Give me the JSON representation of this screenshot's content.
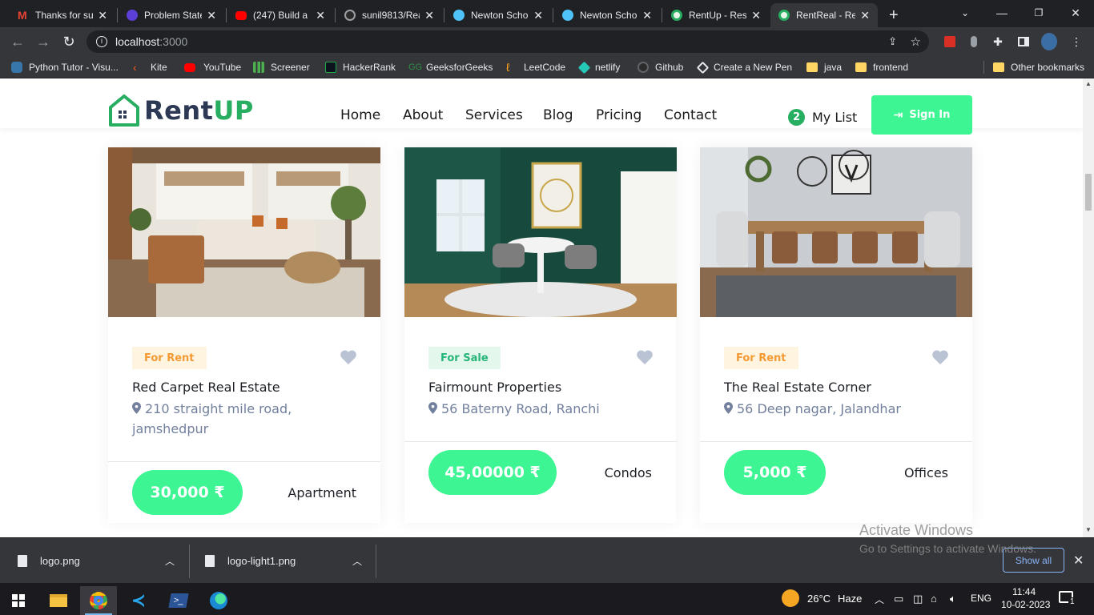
{
  "browser": {
    "tabs": [
      {
        "title": "Thanks for su",
        "favicon_color": "#ea4335"
      },
      {
        "title": "Problem State",
        "favicon_color": "#7b61ff"
      },
      {
        "title": "(247) Build a l",
        "favicon_color": "#ff0000"
      },
      {
        "title": "sunil9813/Rea",
        "favicon_color": "#9aa0a6"
      },
      {
        "title": "Newton Scho",
        "favicon_color": "#4fc3f7"
      },
      {
        "title": "Newton Scho",
        "favicon_color": "#4fc3f7"
      },
      {
        "title": "RentUp - Resi",
        "favicon_color": "#27ae60"
      },
      {
        "title": "RentReal - Re",
        "favicon_color": "#27ae60",
        "active": true
      }
    ],
    "new_tab_label": "+",
    "url": {
      "host": "localhost",
      "port": ":3000"
    },
    "bookmarks": [
      {
        "label": "Python Tutor - Visu...",
        "color": "#3776ab"
      },
      {
        "label": "Kite",
        "color": "#ff5722"
      },
      {
        "label": "YouTube",
        "color": "#ff0000"
      },
      {
        "label": "Screener",
        "color": "#4caf50"
      },
      {
        "label": "HackerRank",
        "color": "#1ba94c"
      },
      {
        "label": "GeeksforGeeks",
        "color": "#2f8d46"
      },
      {
        "label": "LeetCode",
        "color": "#ffa116"
      },
      {
        "label": "netlify",
        "color": "#25c7b7"
      },
      {
        "label": "Github",
        "color": "#9aa0a6"
      },
      {
        "label": "Create a New Pen",
        "color": "#e8eaed"
      },
      {
        "label": "java",
        "color": "#fdd663"
      },
      {
        "label": "frontend",
        "color": "#fdd663"
      }
    ],
    "other_bookmarks": "Other bookmarks"
  },
  "site": {
    "logo": {
      "part1": "Rent",
      "part2": "UP"
    },
    "nav": [
      "Home",
      "About",
      "Services",
      "Blog",
      "Pricing",
      "Contact"
    ],
    "my_list": {
      "count": "2",
      "label": "My List"
    },
    "sign_in": "Sign In",
    "colors": {
      "accent": "#3ef593",
      "brand_green": "#27ae60"
    }
  },
  "listings": [
    {
      "badge": "For Rent",
      "badge_type": "rent",
      "name": "Red Carpet Real Estate",
      "address": "210 straight mile road, jamshedpur",
      "price": "30,000 ₹",
      "type": "Apartment"
    },
    {
      "badge": "For Sale",
      "badge_type": "sale",
      "name": "Fairmount Properties",
      "address": "56 Baterny Road, Ranchi",
      "price": "45,00000 ₹",
      "type": "Condos"
    },
    {
      "badge": "For Rent",
      "badge_type": "rent",
      "name": "The Real Estate Corner",
      "address": "56 Deep nagar, Jalandhar",
      "price": "5,000 ₹",
      "type": "Offices"
    }
  ],
  "downloads": [
    {
      "file": "logo.png"
    },
    {
      "file": "logo-light1.png"
    }
  ],
  "show_all": "Show all",
  "activate": {
    "title": "Activate Windows",
    "subtitle": "Go to Settings to activate Windows."
  },
  "taskbar": {
    "weather_temp": "26°C",
    "weather_desc": "Haze",
    "language": "ENG",
    "time": "11:44",
    "date": "10-02-2023",
    "notifications": "1"
  }
}
